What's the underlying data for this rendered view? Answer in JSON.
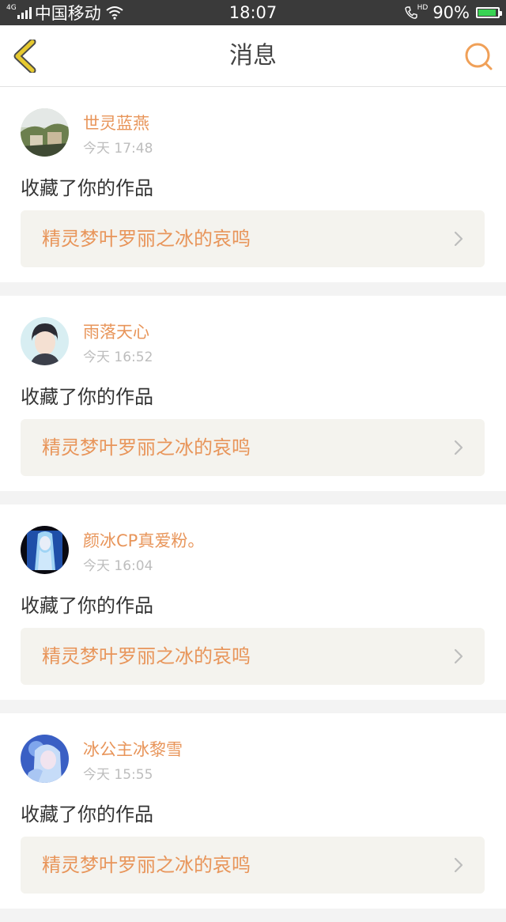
{
  "status_bar": {
    "network_type": "4G",
    "carrier": "中国移动",
    "time": "18:07",
    "call_badge": "HD",
    "battery": "90%",
    "battery_level": 0.9
  },
  "header": {
    "title": "消息",
    "back_icon": "chevron-left-icon",
    "search_icon": "search-icon",
    "accent_color": "#f0a058",
    "back_color": "#e6c92f"
  },
  "messages": [
    {
      "username": "世灵蓝燕",
      "time": "今天 17:48",
      "action": "收藏了你的作品",
      "work_title": "精灵梦叶罗丽之冰的哀鸣"
    },
    {
      "username": "雨落天心",
      "time": "今天 16:52",
      "action": "收藏了你的作品",
      "work_title": "精灵梦叶罗丽之冰的哀鸣"
    },
    {
      "username": "颜冰CP真爱粉。",
      "time": "今天 16:04",
      "action": "收藏了你的作品",
      "work_title": "精灵梦叶罗丽之冰的哀鸣"
    },
    {
      "username": "冰公主冰黎雪",
      "time": "今天 15:55",
      "action": "收藏了你的作品",
      "work_title": "精灵梦叶罗丽之冰的哀鸣"
    }
  ],
  "colors": {
    "username": "#e8955a",
    "work_title": "#e8955a",
    "time": "#bdbdbd",
    "link_background": "#f4f3ee"
  }
}
